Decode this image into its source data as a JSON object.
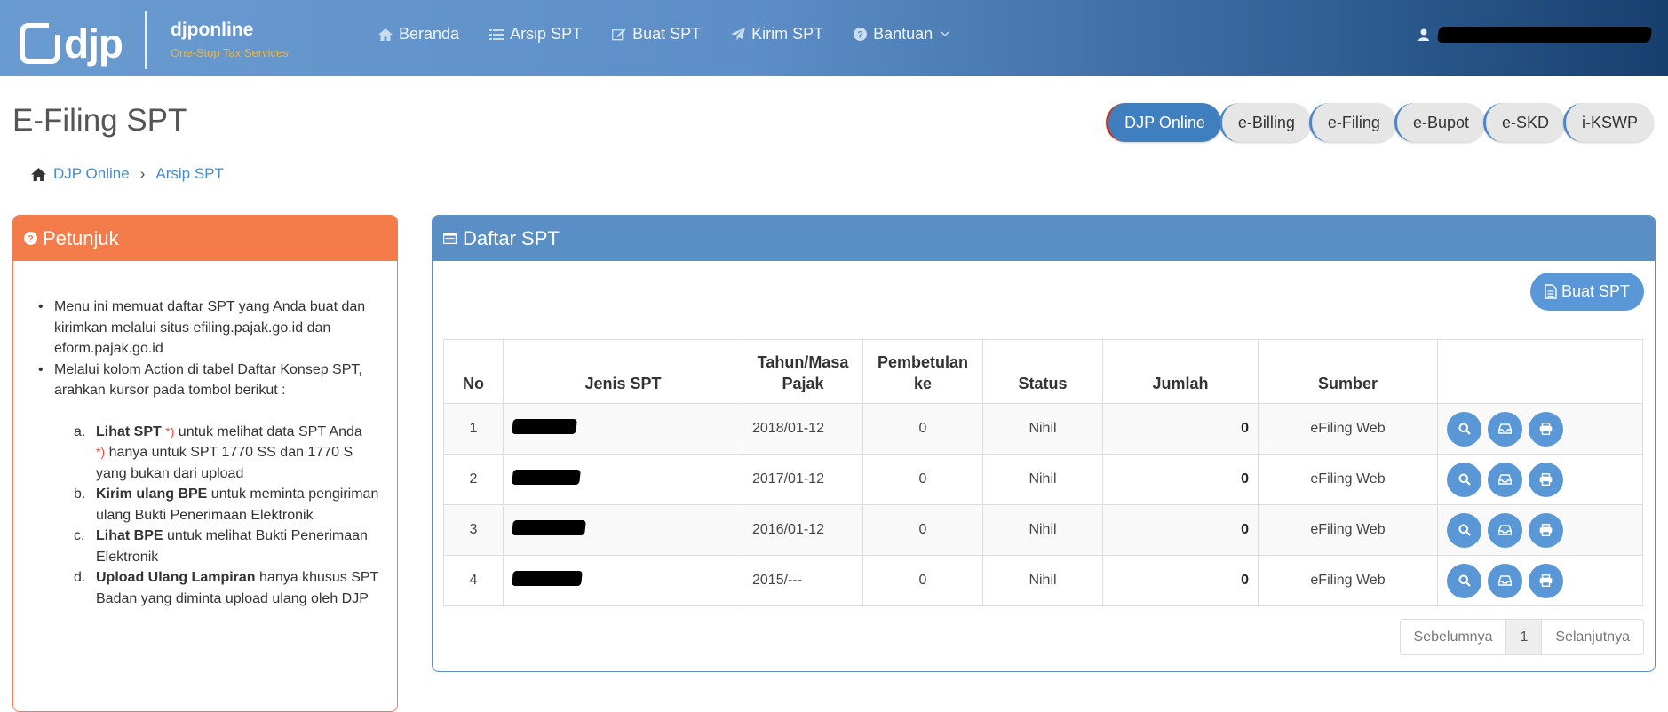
{
  "header": {
    "logo_text": "djp",
    "brand_name": "djponline",
    "brand_tagline": "One-Stop Tax Services",
    "nav": [
      {
        "label": "Beranda",
        "icon": "home-icon"
      },
      {
        "label": "Arsip SPT",
        "icon": "list-icon"
      },
      {
        "label": "Buat SPT",
        "icon": "edit-icon"
      },
      {
        "label": "Kirim SPT",
        "icon": "send-icon"
      },
      {
        "label": "Bantuan",
        "icon": "question-icon"
      }
    ]
  },
  "page": {
    "title": "E-Filing SPT",
    "pills": [
      "DJP Online",
      "e-Billing",
      "e-Filing",
      "e-Bupot",
      "e-SKD",
      "i-KSWP"
    ],
    "breadcrumb": [
      "DJP Online",
      "Arsip SPT"
    ]
  },
  "petunjuk": {
    "title": "Petunjuk",
    "bullet1": "Menu ini memuat daftar SPT yang Anda buat dan kirimkan melalui situs efiling.pajak.go.id dan eform.pajak.go.id",
    "bullet2": "Melalui kolom Action di tabel Daftar Konsep SPT, arahkan kursor pada tombol berikut :",
    "items": [
      {
        "marker": "a.",
        "bold": "Lihat SPT",
        "star": "*)",
        "text": " untuk melihat data SPT Anda",
        "note_star": "*)",
        "note": " hanya untuk SPT 1770 SS dan 1770 S yang bukan dari upload"
      },
      {
        "marker": "b.",
        "bold": "Kirim ulang BPE",
        "text": " untuk meminta pengiriman ulang Bukti Penerimaan Elektronik"
      },
      {
        "marker": "c.",
        "bold": "Lihat BPE",
        "text": " untuk melihat Bukti Penerimaan Elektronik"
      },
      {
        "marker": "d.",
        "bold": "Upload Ulang Lampiran",
        "text": " hanya khusus SPT Badan yang diminta upload ulang oleh DJP"
      }
    ]
  },
  "daftar": {
    "title": "Daftar SPT",
    "buat_label": "Buat SPT",
    "columns": [
      "No",
      "Jenis SPT",
      "Tahun/Masa Pajak",
      "Pembetulan ke",
      "Status",
      "Jumlah",
      "Sumber",
      ""
    ],
    "rows": [
      {
        "no": "1",
        "tahun": "2018/01-12",
        "pembetulan": "0",
        "status": "Nihil",
        "jumlah": "0",
        "sumber": "eFiling Web"
      },
      {
        "no": "2",
        "tahun": "2017/01-12",
        "pembetulan": "0",
        "status": "Nihil",
        "jumlah": "0",
        "sumber": "eFiling Web"
      },
      {
        "no": "3",
        "tahun": "2016/01-12",
        "pembetulan": "0",
        "status": "Nihil",
        "jumlah": "0",
        "sumber": "eFiling Web"
      },
      {
        "no": "4",
        "tahun": "2015/---",
        "pembetulan": "0",
        "status": "Nihil",
        "jumlah": "0",
        "sumber": "eFiling Web"
      }
    ],
    "pager": {
      "prev": "Sebelumnya",
      "current": "1",
      "next": "Selanjutnya"
    }
  },
  "colors": {
    "header": "#5d8ec7",
    "orange": "#f47c4b",
    "blue": "#5a8fc6",
    "link": "#4a8cc7"
  }
}
